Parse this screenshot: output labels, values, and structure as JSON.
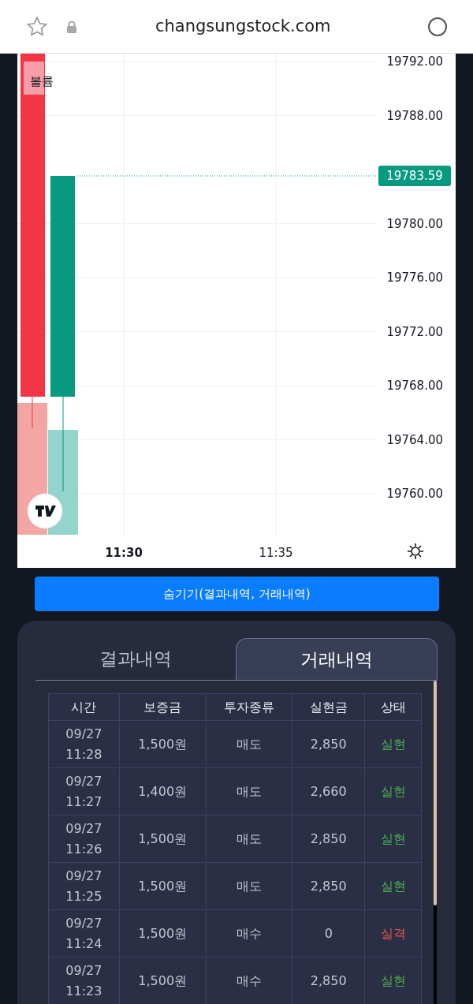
{
  "browser": {
    "url": "changsungstock.com"
  },
  "chart": {
    "legend": "볼륨",
    "price_labels": [
      "19792.00",
      "19788.00",
      "19780.00",
      "19776.00",
      "19772.00",
      "19768.00",
      "19764.00",
      "19760.00"
    ],
    "last_price": "19783.59",
    "time_labels": [
      {
        "label": "11:30",
        "bold": true
      },
      {
        "label": "11:35",
        "bold": false
      }
    ]
  },
  "hide_button": "숨기기(결과내역, 거래내역)",
  "tabs": [
    {
      "label": "결과내역",
      "selected": false
    },
    {
      "label": "거래내역",
      "selected": true
    }
  ],
  "table": {
    "columns": [
      "시간",
      "보증금",
      "투자종류",
      "실현금",
      "상태"
    ],
    "rows": [
      {
        "date": "09/27",
        "time": "11:28",
        "margin": "1,500원",
        "type": "매도",
        "amount": "2,850",
        "status": "실현",
        "color": "#4caf50"
      },
      {
        "date": "09/27",
        "time": "11:27",
        "margin": "1,400원",
        "type": "매도",
        "amount": "2,660",
        "status": "실현",
        "color": "#4caf50"
      },
      {
        "date": "09/27",
        "time": "11:26",
        "margin": "1,500원",
        "type": "매도",
        "amount": "2,850",
        "status": "실현",
        "color": "#4caf50"
      },
      {
        "date": "09/27",
        "time": "11:25",
        "margin": "1,500원",
        "type": "매도",
        "amount": "2,850",
        "status": "실현",
        "color": "#4caf50"
      },
      {
        "date": "09/27",
        "time": "11:24",
        "margin": "1,500원",
        "type": "매수",
        "amount": "0",
        "status": "실격",
        "color": "#e0564b"
      },
      {
        "date": "09/27",
        "time": "11:23",
        "margin": "1,500원",
        "type": "매수",
        "amount": "2,850",
        "status": "실현",
        "color": "#4caf50"
      }
    ]
  }
}
